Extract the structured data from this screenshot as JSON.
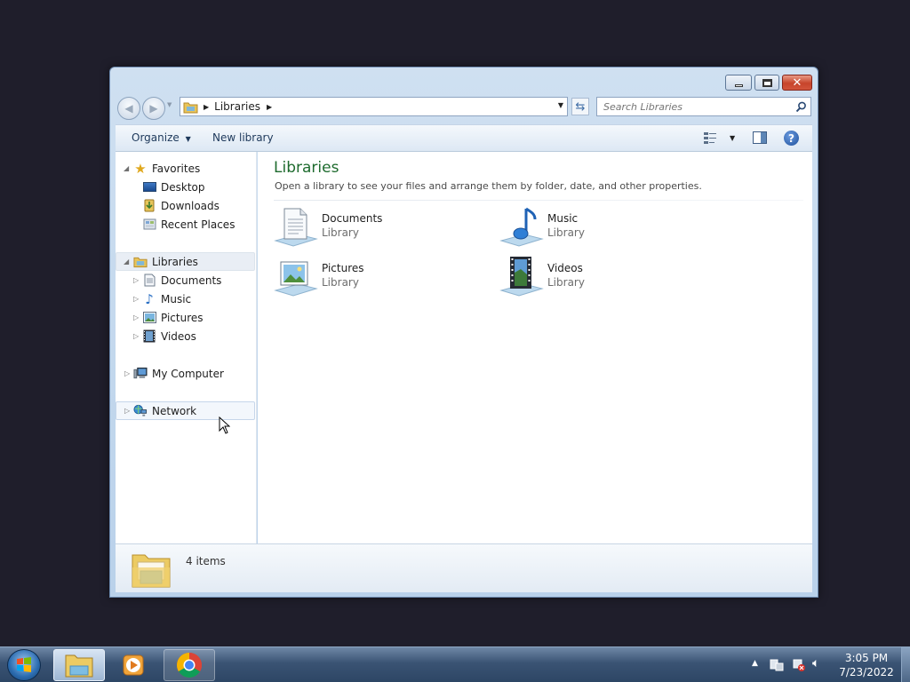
{
  "window": {
    "address": {
      "segment": "Libraries"
    },
    "search": {
      "placeholder": "Search Libraries"
    },
    "commands": {
      "organize": "Organize",
      "new_library": "New library"
    },
    "nav": {
      "favorites": {
        "label": "Favorites",
        "items": [
          "Desktop",
          "Downloads",
          "Recent Places"
        ]
      },
      "libraries": {
        "label": "Libraries",
        "items": [
          "Documents",
          "Music",
          "Pictures",
          "Videos"
        ]
      },
      "computer": "My Computer",
      "network": "Network"
    },
    "content": {
      "title": "Libraries",
      "subtitle": "Open a library to see your files and arrange them by folder, date, and other properties.",
      "libraries": [
        {
          "name": "Documents",
          "type": "Library"
        },
        {
          "name": "Music",
          "type": "Library"
        },
        {
          "name": "Pictures",
          "type": "Library"
        },
        {
          "name": "Videos",
          "type": "Library"
        }
      ]
    },
    "details": {
      "count": "4 items"
    }
  },
  "taskbar": {
    "time": "3:05 PM",
    "date": "7/23/2022"
  },
  "colors": {
    "title_green": "#1e6b2e",
    "desktop": "#1f1e2b",
    "selection": "#e5eef9"
  },
  "icons": [
    "folder-icon",
    "star-icon",
    "desktop-icon",
    "downloads-icon",
    "recent-places-icon",
    "documents-icon",
    "music-icon",
    "pictures-icon",
    "videos-icon",
    "computer-icon",
    "network-icon",
    "help-icon",
    "search-icon",
    "refresh-icon",
    "chrome-icon",
    "media-player-icon",
    "start-orb-icon"
  ]
}
